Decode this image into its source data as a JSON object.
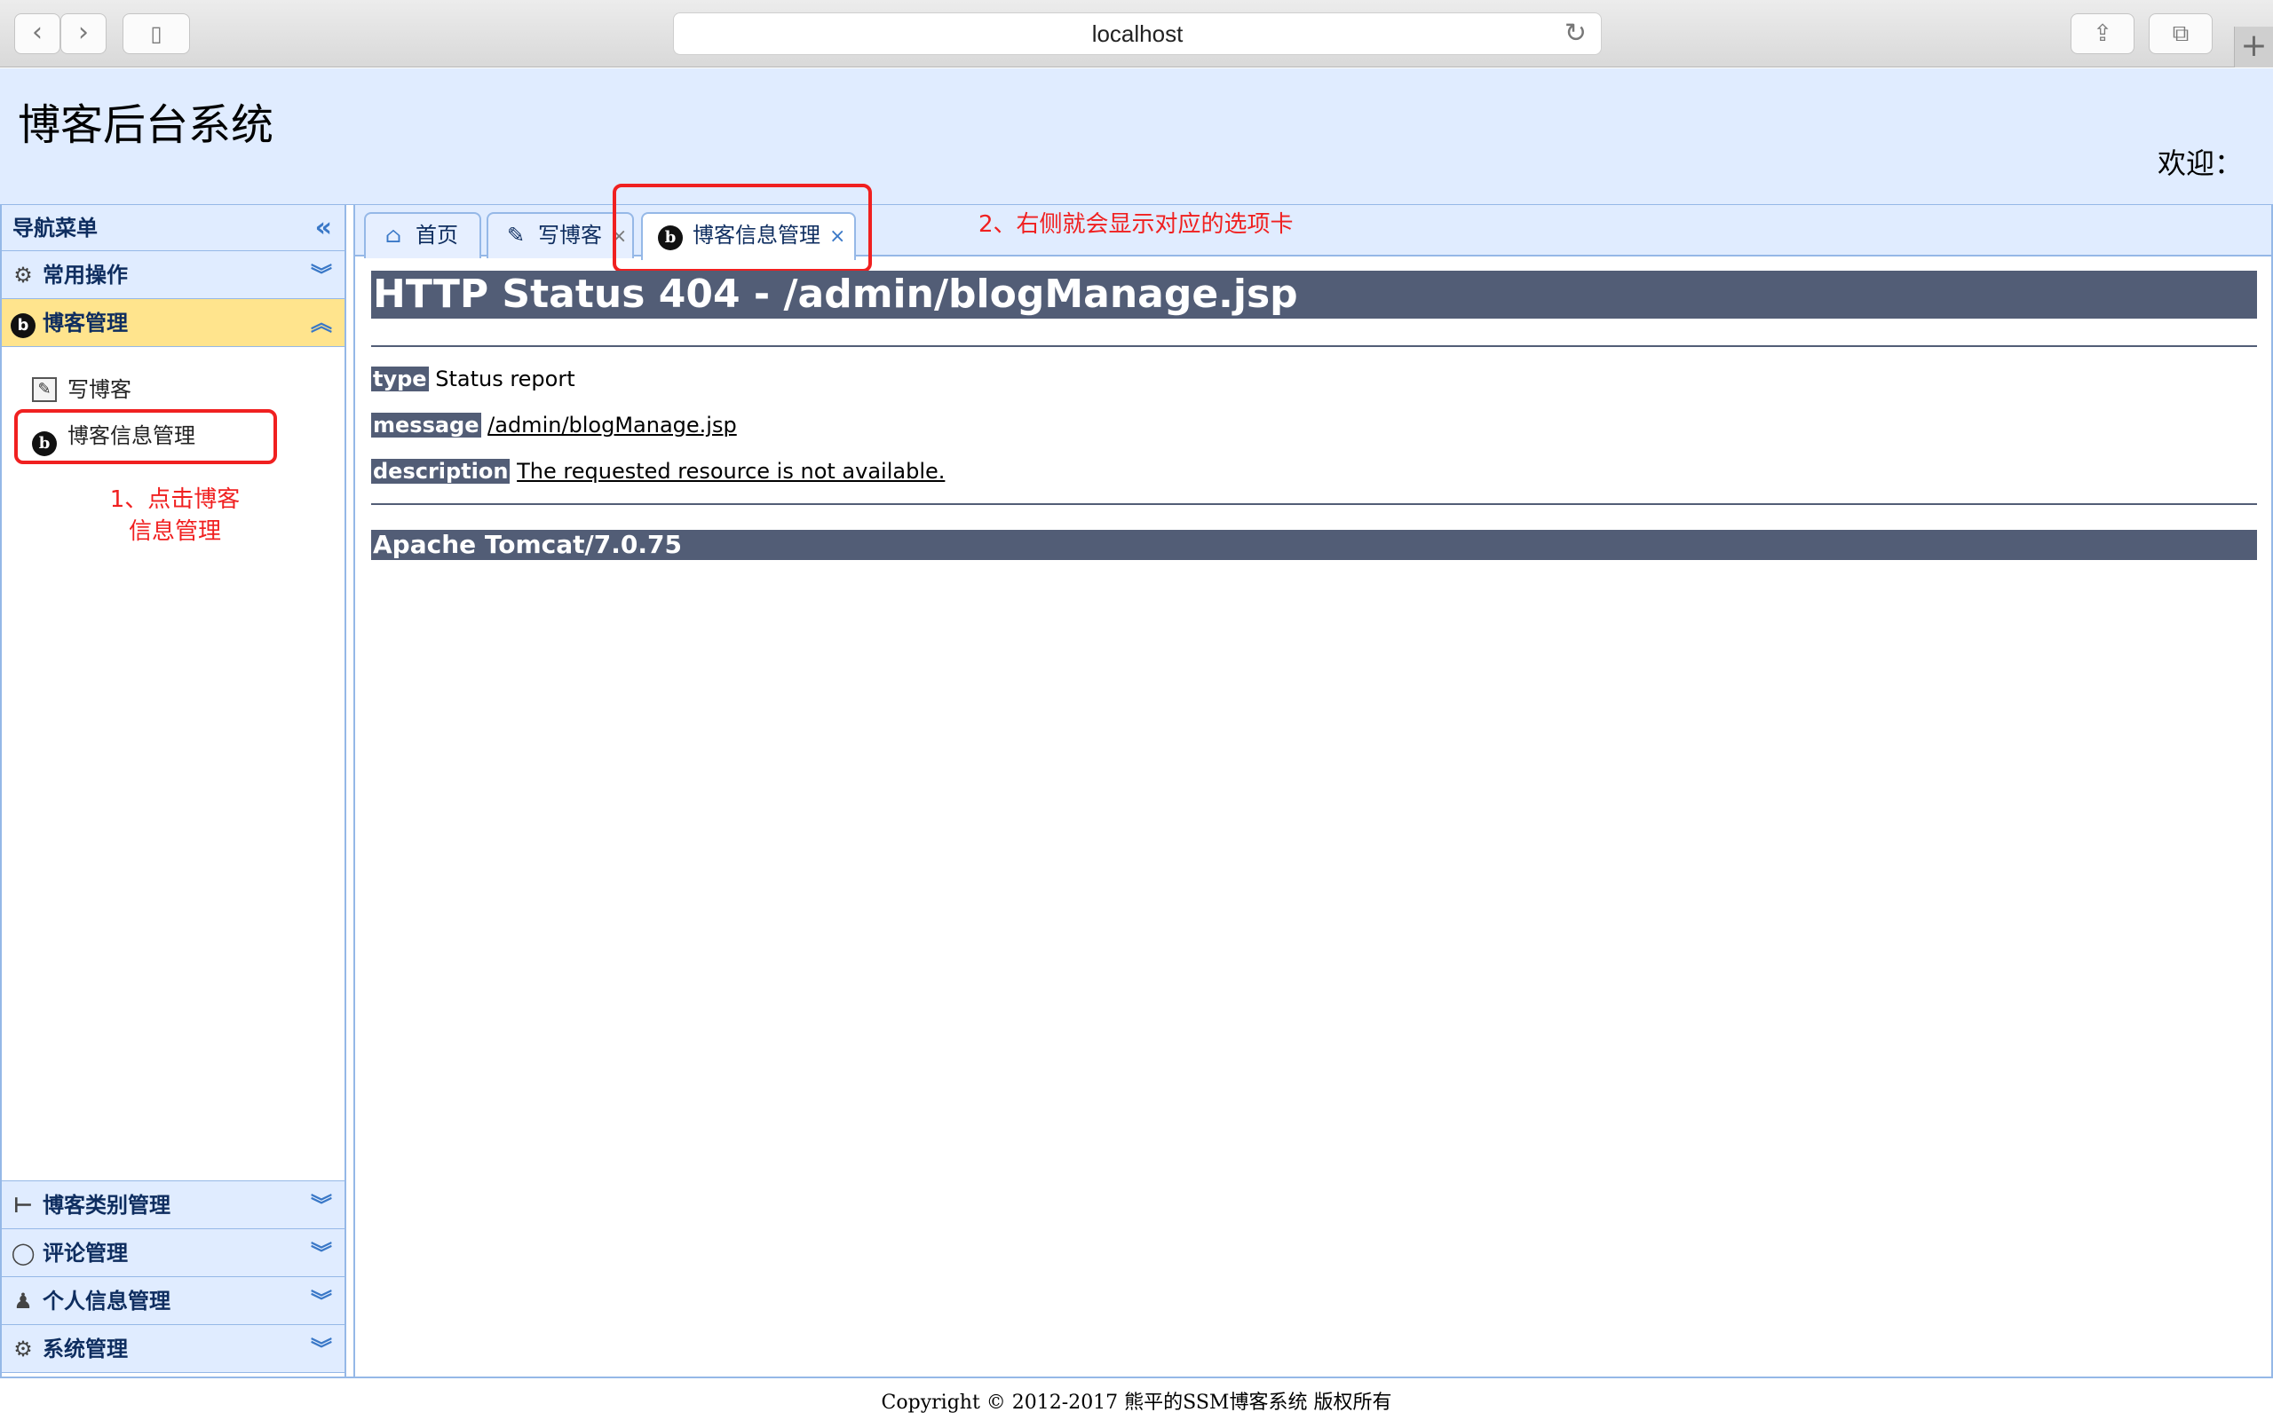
{
  "browser": {
    "url": "localhost",
    "back_icon": "chevron-left-icon",
    "forward_icon": "chevron-right-icon"
  },
  "header": {
    "title": "博客后台系统",
    "welcome": "欢迎："
  },
  "sidebar": {
    "nav_title": "导航菜单",
    "sections": [
      {
        "label": "常用操作",
        "icon": "gear-icon"
      },
      {
        "label": "博客管理",
        "icon": "blog-icon",
        "active": true
      },
      {
        "label": "博客类别管理",
        "icon": "tree-icon"
      },
      {
        "label": "评论管理",
        "icon": "comment-icon"
      },
      {
        "label": "个人信息管理",
        "icon": "user-icon"
      },
      {
        "label": "系统管理",
        "icon": "system-icon"
      }
    ],
    "blog_items": [
      {
        "label": "写博客",
        "icon": "edit-icon"
      },
      {
        "label": "博客信息管理",
        "icon": "blog-icon"
      }
    ]
  },
  "annotations": {
    "step1_line1": "1、点击博客",
    "step1_line2": "信息管理",
    "step2": "2、右侧就会显示对应的选项卡"
  },
  "tabs": [
    {
      "label": "首页",
      "icon": "home-icon",
      "closable": false
    },
    {
      "label": "写博客",
      "icon": "edit-icon",
      "closable": true
    },
    {
      "label": "博客信息管理",
      "icon": "blog-icon",
      "closable": true,
      "active": true
    }
  ],
  "error_page": {
    "title": "HTTP Status 404 - /admin/blogManage.jsp",
    "type_label": "type",
    "type_value": "Status report",
    "message_label": "message",
    "message_value": "/admin/blogManage.jsp",
    "description_label": "description",
    "description_value": "The requested resource is not available.",
    "server": "Apache Tomcat/7.0.75"
  },
  "footer": {
    "copyright": "Copyright © 2012-2017 熊平的SSM博客系统 版权所有"
  },
  "colors": {
    "panel_bg": "#e0ecff",
    "border": "#95b8e7",
    "active_section": "#ffe48d",
    "annotation": "#f02020",
    "tomcat_bar": "#525d76"
  }
}
